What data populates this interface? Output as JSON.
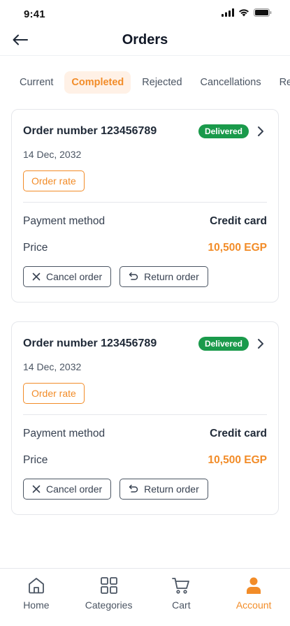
{
  "status_bar": {
    "time": "9:41"
  },
  "header": {
    "title": "Orders"
  },
  "tabs": [
    {
      "label": "Current",
      "active": false
    },
    {
      "label": "Completed",
      "active": true
    },
    {
      "label": "Rejected",
      "active": false
    },
    {
      "label": "Cancellations",
      "active": false
    },
    {
      "label": "Returns",
      "active": false
    }
  ],
  "orders": [
    {
      "number_label": "Order number 123456789",
      "status": "Delivered",
      "date": "14 Dec, 2032",
      "rate_label": "Order rate",
      "payment_label": "Payment method",
      "payment_value": "Credit card",
      "price_label": "Price",
      "price_value": "10,500 EGP",
      "cancel_label": "Cancel order",
      "return_label": "Return order"
    },
    {
      "number_label": "Order number 123456789",
      "status": "Delivered",
      "date": "14 Dec, 2032",
      "rate_label": "Order rate",
      "payment_label": "Payment method",
      "payment_value": "Credit card",
      "price_label": "Price",
      "price_value": "10,500 EGP",
      "cancel_label": "Cancel order",
      "return_label": "Return order"
    }
  ],
  "bottom_nav": [
    {
      "label": "Home",
      "icon": "home-icon",
      "active": false
    },
    {
      "label": "Categories",
      "icon": "grid-icon",
      "active": false
    },
    {
      "label": "Cart",
      "icon": "cart-icon",
      "active": false
    },
    {
      "label": "Account",
      "icon": "user-icon",
      "active": true
    }
  ],
  "colors": {
    "accent": "#f28c28",
    "accent_bg": "#fff1e6",
    "status_green": "#1a9a4b",
    "text_dark": "#1f2937"
  }
}
